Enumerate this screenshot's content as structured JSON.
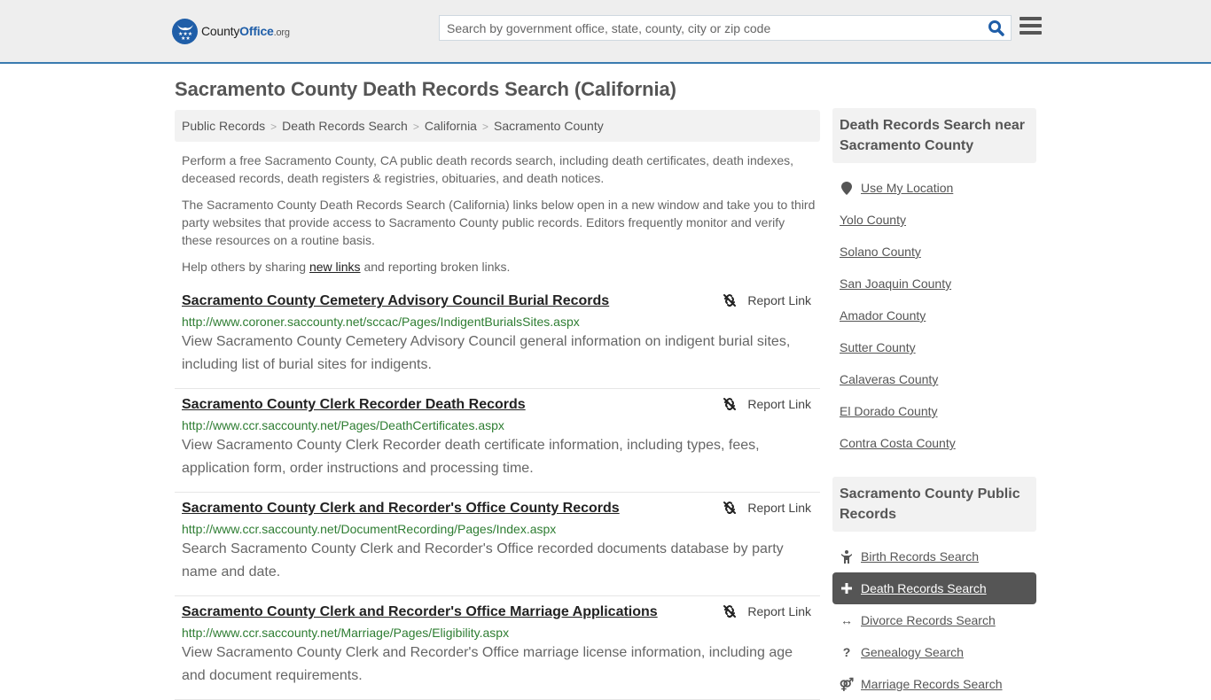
{
  "header": {
    "logo": {
      "county": "County",
      "office": "Office",
      "org": ".org"
    },
    "search": {
      "placeholder": "Search by government office, state, county, city or zip code",
      "value": ""
    }
  },
  "page": {
    "title": "Sacramento County Death Records Search (California)",
    "breadcrumb": [
      "Public Records",
      "Death Records Search",
      "California",
      "Sacramento County"
    ],
    "intro": {
      "p1": "Perform a free Sacramento County, CA public death records search, including death certificates, death indexes, deceased records, death registers & registries, obituaries, and death notices.",
      "p2": "The Sacramento County Death Records Search (California) links below open in a new window and take you to third party websites that provide access to Sacramento County public records. Editors frequently monitor and verify these resources on a routine basis.",
      "p3_before": "Help others by sharing ",
      "p3_link": "new links",
      "p3_after": " and reporting broken links."
    },
    "report_label": "Report Link",
    "results": [
      {
        "title": "Sacramento County Cemetery Advisory Council Burial Records",
        "url": "http://www.coroner.saccounty.net/sccac/Pages/IndigentBurialsSites.aspx",
        "desc": "View Sacramento County Cemetery Advisory Council general information on indigent burial sites, including list of burial sites for indigents."
      },
      {
        "title": "Sacramento County Clerk Recorder Death Records",
        "url": "http://www.ccr.saccounty.net/Pages/DeathCertificates.aspx",
        "desc": "View Sacramento County Clerk Recorder death certificate information, including types, fees, application form, order instructions and processing time."
      },
      {
        "title": "Sacramento County Clerk and Recorder's Office County Records",
        "url": "http://www.ccr.saccounty.net/DocumentRecording/Pages/Index.aspx",
        "desc": "Search Sacramento County Clerk and Recorder's Office recorded documents database by party name and date."
      },
      {
        "title": "Sacramento County Clerk and Recorder's Office Marriage Applications",
        "url": "http://www.ccr.saccounty.net/Marriage/Pages/Eligibility.aspx",
        "desc": "View Sacramento County Clerk and Recorder's Office marriage license information, including age and document requirements."
      }
    ]
  },
  "sidebar": {
    "nearby_title": "Death Records Search near Sacramento County",
    "use_location": "Use My Location",
    "nearby": [
      "Yolo County",
      "Solano County",
      "San Joaquin County",
      "Amador County",
      "Sutter County",
      "Calaveras County",
      "El Dorado County",
      "Contra Costa County"
    ],
    "public_title": "Sacramento County Public Records",
    "public": [
      {
        "label": "Birth Records Search",
        "icon": "child-icon",
        "active": false
      },
      {
        "label": "Death Records Search",
        "icon": "plus-icon",
        "active": true
      },
      {
        "label": "Divorce Records Search",
        "icon": "arrows-horizontal-icon",
        "active": false
      },
      {
        "label": "Genealogy Search",
        "icon": "question-icon",
        "active": false
      },
      {
        "label": "Marriage Records Search",
        "icon": "rings-icon",
        "active": false
      }
    ]
  }
}
